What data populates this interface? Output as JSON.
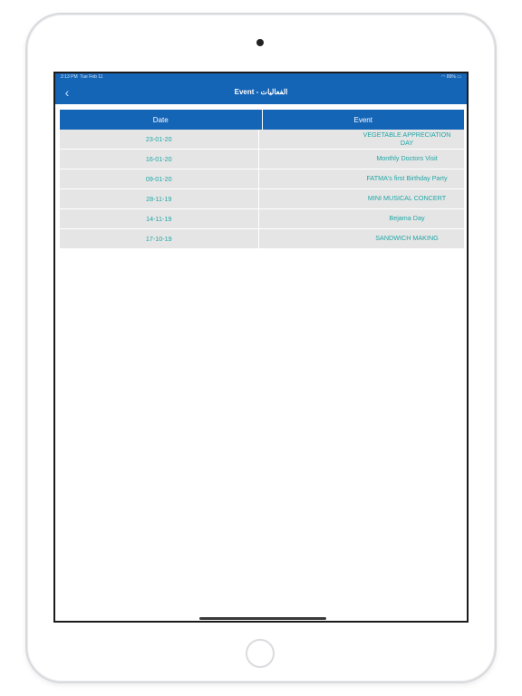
{
  "status": {
    "time": "2:13 PM",
    "date": "Tue Feb 11",
    "battery": "89%"
  },
  "nav": {
    "back_icon": "chevron-left-icon",
    "title": "Event - الفعاليات"
  },
  "table": {
    "headers": {
      "date": "Date",
      "event": "Event"
    },
    "rows": [
      {
        "date": "23-01-20",
        "event": "VEGETABLE APPRECIATION DAY"
      },
      {
        "date": "16-01-20",
        "event": "Monthly Doctors Visit"
      },
      {
        "date": "09-01-20",
        "event": "FATMA's first Birthday Party"
      },
      {
        "date": "28-11-19",
        "event": "MINI MUSICAL CONCERT"
      },
      {
        "date": "14-11-19",
        "event": "Bejama Day"
      },
      {
        "date": "17-10-19",
        "event": "SANDWICH MAKING"
      }
    ]
  },
  "colors": {
    "brand": "#1565b7",
    "row_bg": "#e5e5e5",
    "row_text": "#22a6a6"
  }
}
